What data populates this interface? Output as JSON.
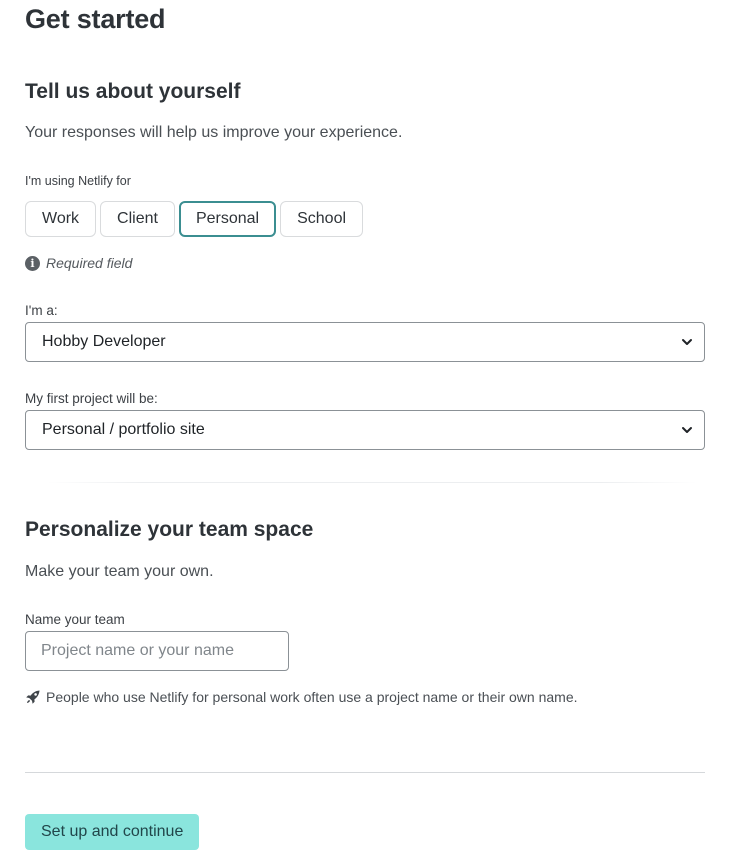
{
  "page": {
    "title": "Get started"
  },
  "about": {
    "title": "Tell us about yourself",
    "description": "Your responses will help us improve your experience.",
    "usage_label": "I'm using Netlify for",
    "usage_options": [
      {
        "label": "Work",
        "selected": false
      },
      {
        "label": "Client",
        "selected": false
      },
      {
        "label": "Personal",
        "selected": true
      },
      {
        "label": "School",
        "selected": false
      }
    ],
    "required_note": "Required field",
    "role_label": "I'm a:",
    "role_value": "Hobby Developer",
    "project_label": "My first project will be:",
    "project_value": "Personal / portfolio site"
  },
  "team": {
    "title": "Personalize your team space",
    "description": "Make your team your own.",
    "name_label": "Name your team",
    "name_value": "",
    "name_placeholder": "Project name or your name",
    "hint": "People who use Netlify for personal work often use a project name or their own name."
  },
  "actions": {
    "submit_label": "Set up and continue"
  },
  "icons": {
    "info": "info-icon",
    "chevron": "chevron-down-icon",
    "hint": "rocket-icon"
  },
  "colors": {
    "selected_border": "#3b8e91",
    "primary_button": "#8ae5dd",
    "primary_button_text": "#21464a"
  }
}
